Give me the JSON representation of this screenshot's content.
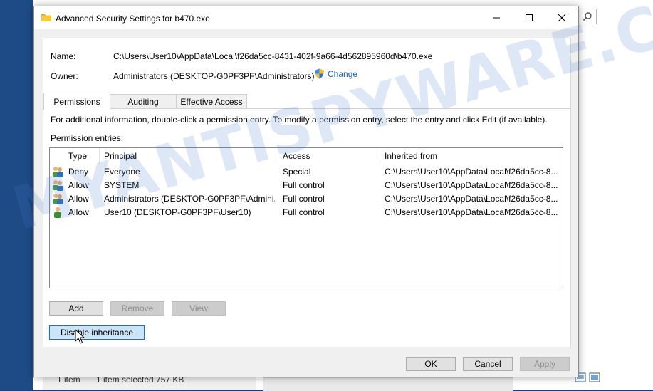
{
  "background": {
    "status_items": "1 item",
    "status_selected": "1 item selected  757 KB"
  },
  "watermark": "MYANTISPYWARE.COM",
  "dialog": {
    "title": "Advanced Security Settings for b470.exe",
    "name_label": "Name:",
    "name_value": "C:\\Users\\User10\\AppData\\Local\\f26da5cc-8431-402f-9a66-4d562895960d\\b470.exe",
    "owner_label": "Owner:",
    "owner_value": "Administrators (DESKTOP-G0PF3PF\\Administrators)",
    "change_label": "Change",
    "tabs": [
      {
        "label": "Permissions",
        "active": true
      },
      {
        "label": "Auditing",
        "active": false
      },
      {
        "label": "Effective Access",
        "active": false
      }
    ],
    "info_text": "For additional information, double-click a permission entry. To modify a permission entry, select the entry and click Edit (if available).",
    "entries_label": "Permission entries:",
    "columns": {
      "type": "Type",
      "principal": "Principal",
      "access": "Access",
      "inherited": "Inherited from"
    },
    "rows": [
      {
        "type": "Deny",
        "principal": "Everyone",
        "access": "Special",
        "inherited": "C:\\Users\\User10\\AppData\\Local\\f26da5cc-8...",
        "icon": "group-users-icon"
      },
      {
        "type": "Allow",
        "principal": "SYSTEM",
        "access": "Full control",
        "inherited": "C:\\Users\\User10\\AppData\\Local\\f26da5cc-8...",
        "icon": "group-users-icon"
      },
      {
        "type": "Allow",
        "principal": "Administrators (DESKTOP-G0PF3PF\\Admini...",
        "access": "Full control",
        "inherited": "C:\\Users\\User10\\AppData\\Local\\f26da5cc-8...",
        "icon": "group-users-icon"
      },
      {
        "type": "Allow",
        "principal": "User10 (DESKTOP-G0PF3PF\\User10)",
        "access": "Full control",
        "inherited": "C:\\Users\\User10\\AppData\\Local\\f26da5cc-8...",
        "icon": "single-user-icon"
      }
    ],
    "buttons": {
      "add": "Add",
      "remove": "Remove",
      "view": "View",
      "disable_inheritance": "Disable inheritance",
      "ok": "OK",
      "cancel": "Cancel",
      "apply": "Apply"
    }
  }
}
